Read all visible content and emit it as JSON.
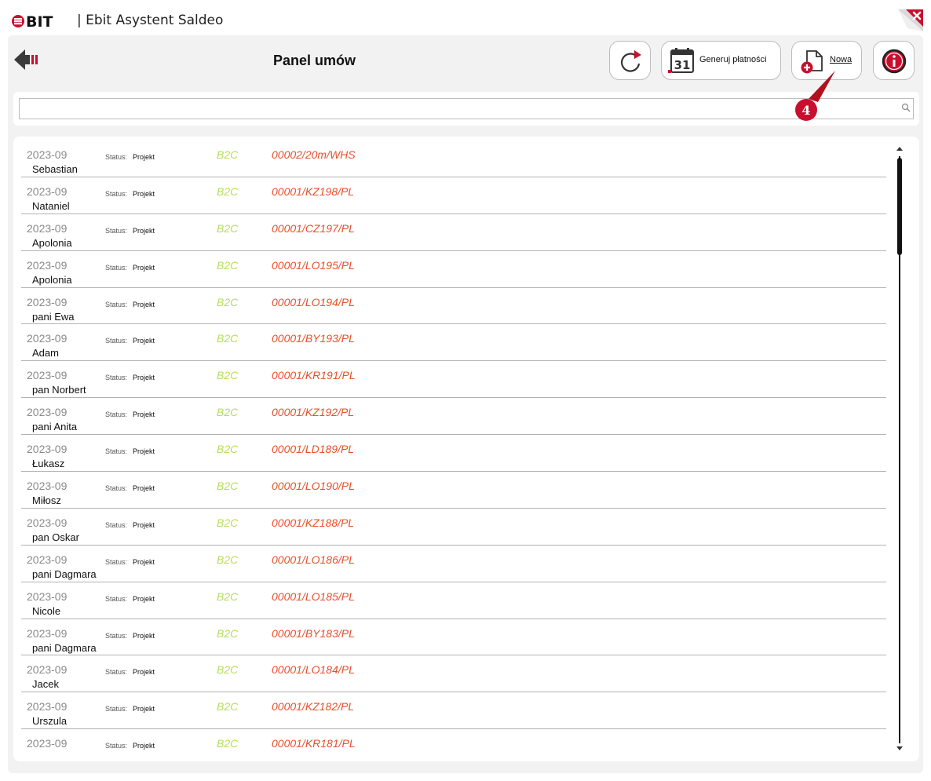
{
  "app": {
    "brand": "BIT",
    "title": "| Ebit Asystent Saldeo"
  },
  "header": {
    "title": "Panel umów",
    "generate_label": "Generuj płatności",
    "new_label": "Nowa",
    "calendar_day": "31",
    "callout_number": "4"
  },
  "search": {
    "value": "",
    "placeholder": ""
  },
  "colors": {
    "accent_red": "#c8102e",
    "type_green": "#b6de5a",
    "number_orange": "#e8502c"
  },
  "status_label": "Status:",
  "rows": [
    {
      "period": "2023-09",
      "name": "Sebastian",
      "status": "Projekt",
      "type": "B2C",
      "number": "00002/20m/WHS"
    },
    {
      "period": "2023-09",
      "name": "Nataniel",
      "status": "Projekt",
      "type": "B2C",
      "number": "00001/KZ198/PL"
    },
    {
      "period": "2023-09",
      "name": "Apolonia",
      "status": "Projekt",
      "type": "B2C",
      "number": "00001/CZ197/PL"
    },
    {
      "period": "2023-09",
      "name": "Apolonia",
      "status": "Projekt",
      "type": "B2C",
      "number": "00001/LO195/PL"
    },
    {
      "period": "2023-09",
      "name": "pani Ewa",
      "status": "Projekt",
      "type": "B2C",
      "number": "00001/LO194/PL"
    },
    {
      "period": "2023-09",
      "name": "Adam",
      "status": "Projekt",
      "type": "B2C",
      "number": "00001/BY193/PL"
    },
    {
      "period": "2023-09",
      "name": "pan Norbert",
      "status": "Projekt",
      "type": "B2C",
      "number": "00001/KR191/PL"
    },
    {
      "period": "2023-09",
      "name": "pani Anita",
      "status": "Projekt",
      "type": "B2C",
      "number": "00001/KZ192/PL"
    },
    {
      "period": "2023-09",
      "name": "Łukasz",
      "status": "Projekt",
      "type": "B2C",
      "number": "00001/LD189/PL"
    },
    {
      "period": "2023-09",
      "name": "Miłosz",
      "status": "Projekt",
      "type": "B2C",
      "number": "00001/LO190/PL"
    },
    {
      "period": "2023-09",
      "name": "pan Oskar",
      "status": "Projekt",
      "type": "B2C",
      "number": "00001/KZ188/PL"
    },
    {
      "period": "2023-09",
      "name": "pani Dagmara",
      "status": "Projekt",
      "type": "B2C",
      "number": "00001/LO186/PL"
    },
    {
      "period": "2023-09",
      "name": "Nicole",
      "status": "Projekt",
      "type": "B2C",
      "number": "00001/LO185/PL"
    },
    {
      "period": "2023-09",
      "name": "pani Dagmara",
      "status": "Projekt",
      "type": "B2C",
      "number": "00001/BY183/PL"
    },
    {
      "period": "2023-09",
      "name": "Jacek",
      "status": "Projekt",
      "type": "B2C",
      "number": "00001/LO184/PL"
    },
    {
      "period": "2023-09",
      "name": "Urszula",
      "status": "Projekt",
      "type": "B2C",
      "number": "00001/KZ182/PL"
    },
    {
      "period": "2023-09",
      "name": "",
      "status": "Projekt",
      "type": "B2C",
      "number": "00001/KR181/PL"
    }
  ]
}
